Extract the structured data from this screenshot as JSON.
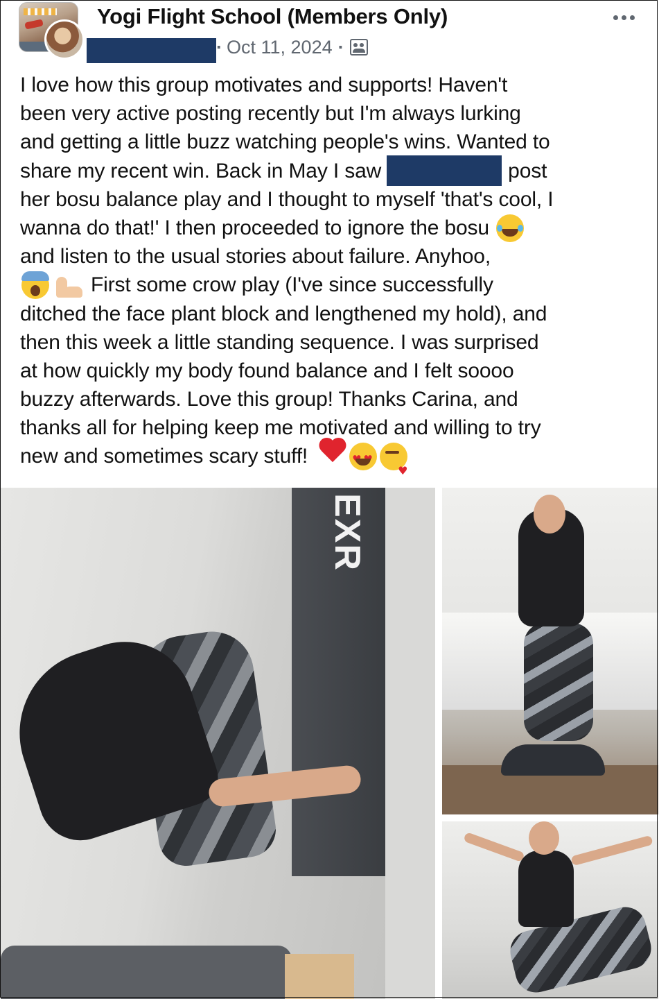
{
  "header": {
    "group_name": "Yogi Flight School (Members Only)",
    "date": "Oct 11, 2024",
    "separator": "·",
    "audience_icon": "members-icon",
    "more_icon": "more-dots-icon"
  },
  "post": {
    "lines": [
      "I love how this group motivates and supports! Haven't",
      "been very active posting recently but I'm always lurking",
      "and getting a little buzz watching people's wins. Wanted to",
      "share my recent win. Back in May I saw",
      "post",
      "her bosu balance play and I thought to myself 'that's cool, I",
      "wanna do that!' I then proceeded to ignore the bosu",
      "and listen to the usual stories about failure. Anyhoo,",
      "First some crow play (I've since successfully",
      "ditched the face plant block and lengthened my hold), and",
      "then this week a little standing sequence. I was surprised",
      "at how quickly my body found balance and I felt soooo",
      "buzzy afterwards. Love this group! Thanks Carina, and",
      "thanks all for helping keep me motivated and willing to try",
      "new and sometimes scary stuff!"
    ],
    "emojis": [
      "laughing-emoji",
      "screaming-emoji",
      "flexed-biceps-emoji",
      "red-heart-emoji",
      "heart-eyes-emoji",
      "kissing-emoji"
    ]
  },
  "photos": {
    "main_brand_text": "EXR",
    "colors": {
      "redaction": "#1e3a66",
      "meta_gray": "#606770"
    }
  }
}
